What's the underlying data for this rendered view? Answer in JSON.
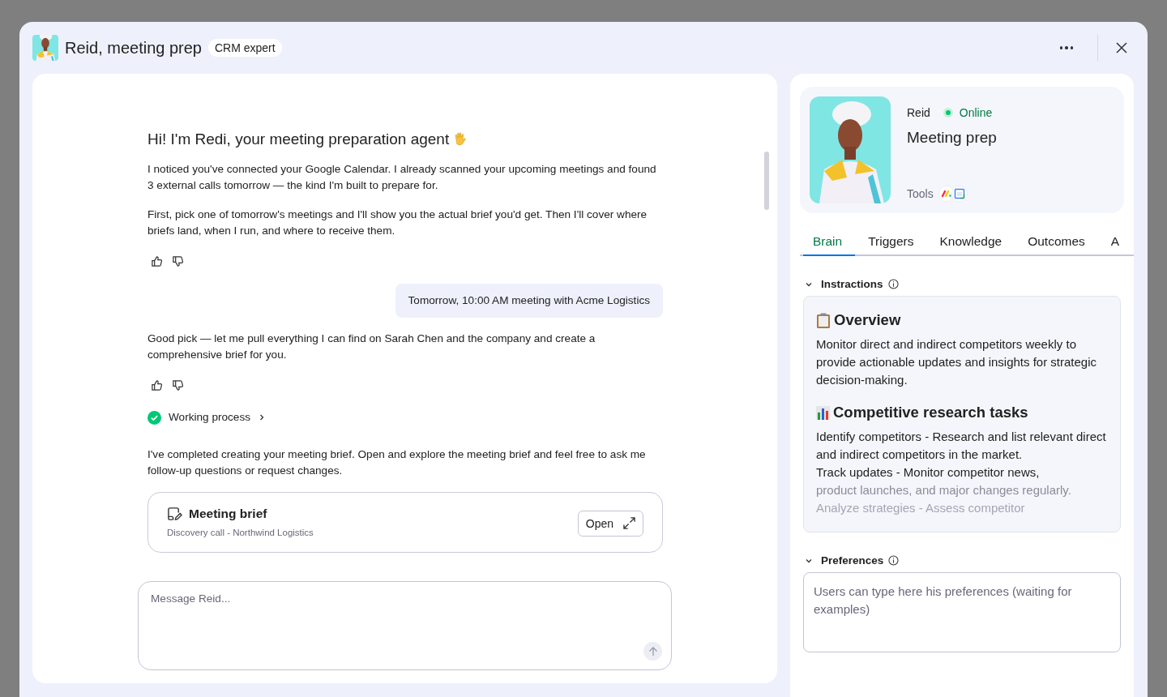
{
  "header": {
    "title": "Reid, meeting prep",
    "badge": "CRM expert"
  },
  "chat": {
    "messages": [
      {
        "kind": "agent",
        "heading": "Hi! I'm Redi, your meeting preparation agent",
        "paragraphs": [
          "I noticed you've connected your Google Calendar. I already scanned your upcoming meetings and found 3 external calls tomorrow — the kind I'm built to prepare for.",
          "First, pick one of tomorrow's meetings and I'll show you the actual brief you'd get. Then I'll cover where briefs land, when I run, and where to receive them."
        ],
        "feedback": true
      },
      {
        "kind": "user",
        "text": "Tomorrow, 10:00 AM meeting with Acme Logistics"
      },
      {
        "kind": "agent",
        "paragraphs": [
          "Good pick — let me pull everything I can find on Sarah Chen and the company and create a comprehensive brief for you."
        ],
        "feedback": true
      },
      {
        "kind": "process",
        "label": "Working process",
        "done": true,
        "expanded": false
      },
      {
        "kind": "agent",
        "paragraphs": [
          "I've completed creating your meeting brief. Open and explore the meeting brief and feel free to ask me follow-up questions or request changes."
        ],
        "feedback": false
      },
      {
        "kind": "artifact",
        "title": "Meeting brief",
        "subtitle": "Discovery call - Northwind Logistics",
        "action": "Open"
      }
    ],
    "composer": {
      "placeholder": "Message Reid..."
    }
  },
  "profile": {
    "name": "Reid",
    "status": "Online",
    "online": true,
    "role": "Meeting prep",
    "tools_label": "Tools"
  },
  "tabs": [
    {
      "label": "Brain",
      "selected": true
    },
    {
      "label": "Triggers",
      "selected": false
    },
    {
      "label": "Knowledge",
      "selected": false
    },
    {
      "label": "Outcomes",
      "selected": false
    },
    {
      "label": "A",
      "selected": false
    }
  ],
  "sections": [
    {
      "kind": "content",
      "title": "Instractions",
      "expanded": true,
      "blocks": [
        {
          "kind": "heading",
          "text": "Overview"
        },
        {
          "kind": "text",
          "text": "Monitor direct and indirect competitors weekly to provide actionable updates and insights for strategic decision-making."
        },
        {
          "kind": "heading",
          "text": "Competitive research tasks"
        },
        {
          "kind": "text",
          "text": "Identify competitors - Research and list relevant direct and indirect competitors in the market."
        },
        {
          "kind": "text",
          "text": "Track updates - Monitor competitor news,"
        },
        {
          "kind": "faded",
          "text": "product launches, and major changes regularly."
        },
        {
          "kind": "faded2",
          "text": "Analyze strategies - Assess competitor"
        }
      ]
    },
    {
      "kind": "input",
      "title": "Preferences",
      "expanded": true,
      "placeholder": "Users can type here his preferences (waiting for examples)"
    }
  ]
}
